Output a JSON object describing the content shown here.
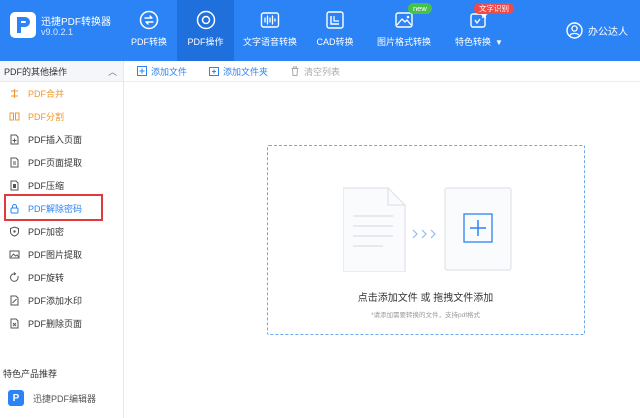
{
  "brand": {
    "name": "迅捷PDF转换器",
    "version": "v9.0.2.1"
  },
  "nav": {
    "tabs": [
      {
        "label": "PDF转换",
        "icon": "convert-icon",
        "active": false
      },
      {
        "label": "PDF操作",
        "icon": "gear-icon",
        "active": true
      },
      {
        "label": "文字语音转换",
        "icon": "audio-wave-icon",
        "active": false
      },
      {
        "label": "CAD转换",
        "icon": "cad-icon",
        "active": false
      },
      {
        "label": "图片格式转换",
        "icon": "image-icon",
        "active": false,
        "badge": "new"
      },
      {
        "label": "特色转换",
        "icon": "feature-icon",
        "active": false,
        "badge": "文字识别",
        "dropdown": "▼"
      }
    ]
  },
  "user": {
    "name": "办公达人",
    "icon": "user-circle-icon"
  },
  "sidebar": {
    "header": "PDF的其他操作",
    "collapse": "︿",
    "items": [
      {
        "label": "PDF合并",
        "icon": "merge-icon"
      },
      {
        "label": "PDF分割",
        "icon": "split-icon"
      },
      {
        "label": "PDF插入页面",
        "icon": "insert-page-icon"
      },
      {
        "label": "PDF页面提取",
        "icon": "extract-page-icon"
      },
      {
        "label": "PDF压缩",
        "icon": "compress-icon"
      },
      {
        "label": "PDF解除密码",
        "icon": "lock-icon"
      },
      {
        "label": "PDF加密",
        "icon": "shield-icon"
      },
      {
        "label": "PDF图片提取",
        "icon": "image-extract-icon"
      },
      {
        "label": "PDF旋转",
        "icon": "rotate-icon"
      },
      {
        "label": "PDF添加水印",
        "icon": "watermark-icon"
      },
      {
        "label": "PDF删除页面",
        "icon": "delete-page-icon"
      }
    ],
    "featured_title": "特色产品推荐",
    "featured_product": "迅捷PDF编辑器"
  },
  "toolbar": {
    "add_file": "添加文件",
    "add_folder": "添加文件夹",
    "clear_list": "清空列表"
  },
  "dropzone": {
    "main_text": "点击添加文件 或 拖拽文件添加",
    "sub_text": "*请添加需要转换的文件，支持pdf格式"
  },
  "colors": {
    "header_bg": "#2b83f6",
    "active_tab_bg": "#1f6fdc",
    "accent_blue": "#2b83f6",
    "orange_text": "#f0962a",
    "highlight_red": "#e23a3a",
    "badge_green": "#46c24a",
    "badge_red": "#f0494a"
  }
}
